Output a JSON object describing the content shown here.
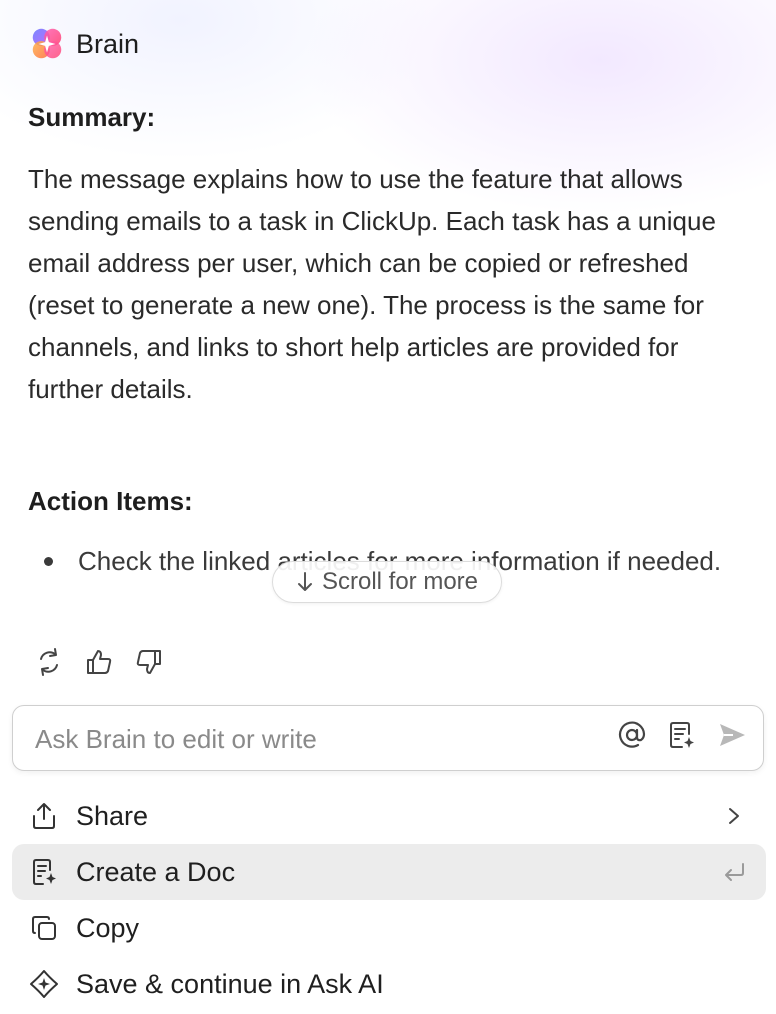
{
  "header": {
    "title": "Brain",
    "logo_icon": "brain-logo-icon"
  },
  "summary": {
    "heading": "Summary:",
    "text": "The message explains how to use the feature that allows sending emails to a task in ClickUp. Each task has a unique email address per user, which can be copied or refreshed (reset to generate a new one). The process is the same for channels, and links to short help articles are provided for further details."
  },
  "action_items": {
    "heading": "Action Items:",
    "items": [
      "Check the linked articles for more information if needed."
    ]
  },
  "scroll_hint": {
    "label": "Scroll for more",
    "icon": "arrow-down-icon"
  },
  "feedback": {
    "icons": [
      "regenerate-icon",
      "thumbs-up-icon",
      "thumbs-down-icon"
    ]
  },
  "prompt_input": {
    "placeholder": "Ask Brain to edit or write",
    "icons": [
      "mention-icon",
      "doc-context-icon",
      "send-icon"
    ]
  },
  "menu": {
    "items": [
      {
        "label": "Share",
        "icon": "share-icon",
        "trailing": "chevron-right-icon"
      },
      {
        "label": "Create a Doc",
        "icon": "create-doc-icon",
        "trailing": "enter-key-icon",
        "highlighted": true
      },
      {
        "label": "Copy",
        "icon": "copy-icon"
      },
      {
        "label": "Save & continue in Ask AI",
        "icon": "ai-sparkle-icon"
      }
    ]
  },
  "colors": {
    "accent_pink": "#f13c8e",
    "accent_purple": "#7b5cff",
    "accent_orange": "#ff7a3d",
    "highlight_row": "#ececec"
  }
}
